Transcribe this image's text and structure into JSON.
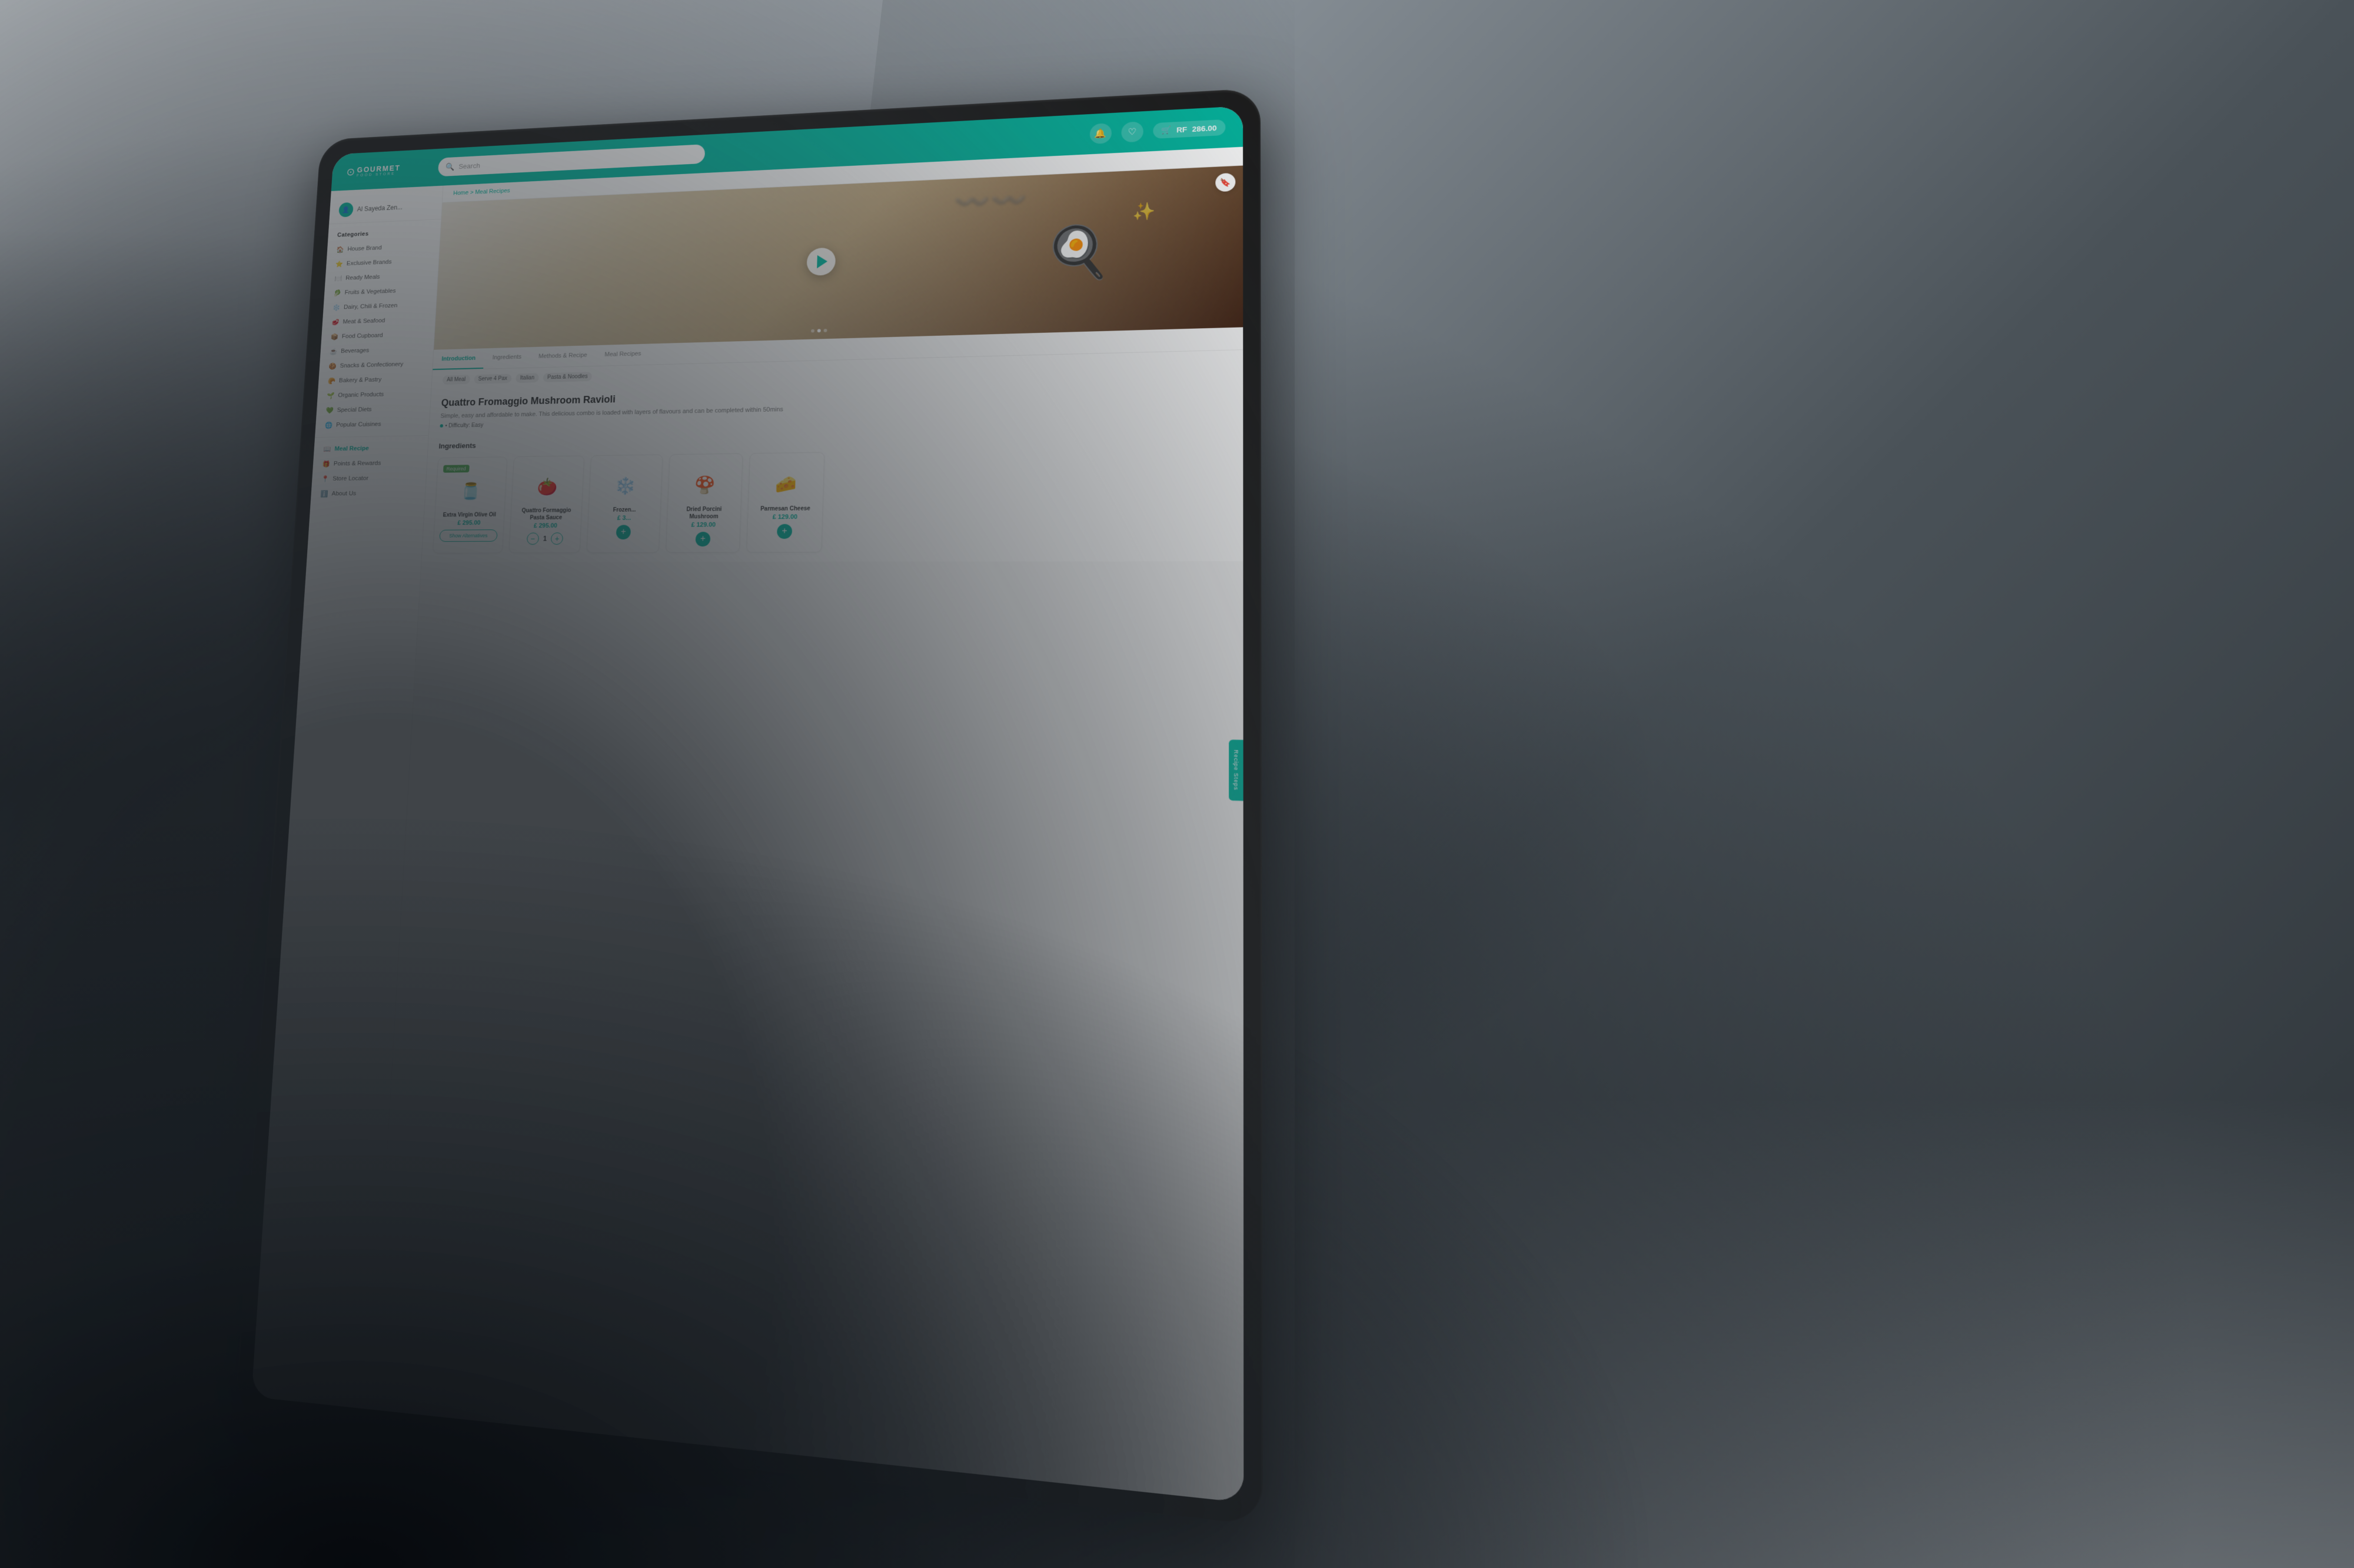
{
  "scene": {
    "background": "person holding tablet showing gourmet food store website"
  },
  "header": {
    "logo": "GOURMET",
    "logo_sub": "FOOD STORE",
    "search_placeholder": "Search",
    "cart_amount": "286.00",
    "currency": "RF",
    "user": "Al Sayeda Zen..."
  },
  "sidebar": {
    "categories_title": "Categories",
    "items": [
      {
        "label": "House Brand",
        "icon": "home",
        "active": false
      },
      {
        "label": "Exclusive Brands",
        "icon": "star",
        "active": false
      },
      {
        "label": "Ready Meals",
        "icon": "utensils",
        "active": false
      },
      {
        "label": "Fruits & Vegetables",
        "icon": "leaf",
        "active": false
      },
      {
        "label": "Dairy, Chili & Frozen",
        "icon": "snowflake",
        "active": false
      },
      {
        "label": "Meat & Seafood",
        "icon": "fish",
        "active": false
      },
      {
        "label": "Food Cupboard",
        "icon": "box",
        "active": false
      },
      {
        "label": "Beverages",
        "icon": "coffee",
        "active": false
      },
      {
        "label": "Snacks & Confectionery",
        "icon": "cookie",
        "active": false
      },
      {
        "label": "Bakery & Pastry",
        "icon": "bread",
        "active": false
      },
      {
        "label": "Organic Products",
        "icon": "seedling",
        "active": false
      },
      {
        "label": "Special Diets",
        "icon": "heart",
        "active": false
      },
      {
        "label": "Popular Cuisines",
        "icon": "globe",
        "active": false
      }
    ],
    "menu_items": [
      {
        "label": "Meal Recipe",
        "icon": "book",
        "active": true
      },
      {
        "label": "Points & Rewards",
        "icon": "gift",
        "active": false
      },
      {
        "label": "Store Locator",
        "icon": "map-pin",
        "active": false
      },
      {
        "label": "About Us",
        "icon": "info",
        "active": false
      }
    ]
  },
  "breadcrumb": {
    "home": "Home",
    "separator": ">",
    "current": "Meal Recipes"
  },
  "tabs": [
    {
      "label": "Introduction",
      "active": true
    },
    {
      "label": "Ingredients",
      "active": false
    },
    {
      "label": "Methods & Recipe",
      "active": false
    },
    {
      "label": "Meal Recipes",
      "active": false
    }
  ],
  "filter_tags": [
    {
      "label": "All Meal",
      "active": false
    },
    {
      "label": "Serve 4 Pax",
      "active": false
    },
    {
      "label": "Italian",
      "active": false
    },
    {
      "label": "Pasta & Noodles",
      "active": false
    }
  ],
  "recipe": {
    "title": "Quattro Fromaggio Mushroom Ravioli",
    "description": "Simple, easy and affordable to make. This delicious combo is loaded with layers of flavours and can be completed within 50mins",
    "difficulty_label": "• Difficulty: Easy"
  },
  "ingredients": {
    "section_title": "Ingredients",
    "items": [
      {
        "name": "Extra Virgin Olive Oil",
        "price": "£ 295.00",
        "badge": "Required",
        "emoji": "🫙",
        "has_alternatives": true,
        "qty": null
      },
      {
        "name": "Quattro Formaggio Pasta Sauce",
        "price": "£ 295.00",
        "badge": null,
        "emoji": "🍅",
        "has_alternatives": false,
        "qty": 1
      },
      {
        "name": "Frozen...",
        "price": "£ 3...",
        "badge": null,
        "emoji": "❄️",
        "has_alternatives": false,
        "qty": null
      },
      {
        "name": "Dried Porcini Mushroom",
        "price": "£ 129.00",
        "badge": null,
        "emoji": "🍄",
        "has_alternatives": false,
        "qty": null
      },
      {
        "name": "Parmesan Cheese",
        "price": "£ 129.00",
        "badge": null,
        "emoji": "🧀",
        "has_alternatives": false,
        "qty": null
      }
    ]
  }
}
